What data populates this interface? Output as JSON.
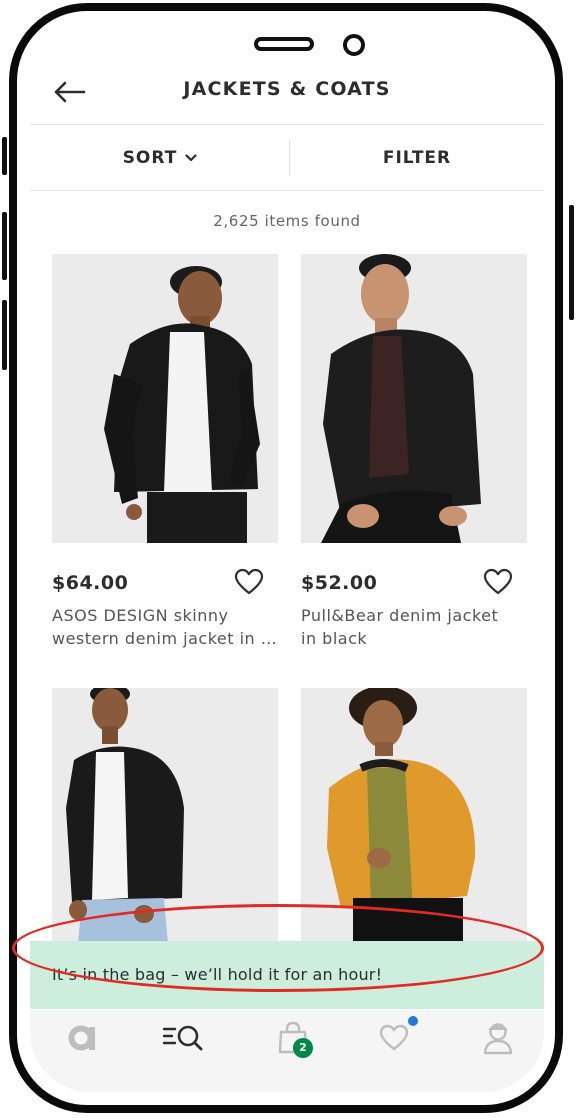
{
  "header": {
    "title": "JACKETS & COATS"
  },
  "toolbar": {
    "sort_label": "SORT",
    "filter_label": "FILTER"
  },
  "results": {
    "count_text": "2,625 items found"
  },
  "products": [
    {
      "price": "$64.00",
      "title_line1": "ASOS DESIGN skinny",
      "title_line2": "western denim jacket in b..."
    },
    {
      "price": "$52.00",
      "title_line1": "Pull&Bear denim jacket",
      "title_line2": "in black"
    },
    {
      "price": "",
      "title_line1": "",
      "title_line2": ""
    },
    {
      "price": "",
      "title_line1": "",
      "title_line2": ""
    }
  ],
  "toast": {
    "message": "It’s in the bag – we’ll hold it for an hour!"
  },
  "tabbar": {
    "bag_count": "2"
  },
  "colors": {
    "toast_bg": "#cdeedc",
    "badge_green": "#018849",
    "notification_blue": "#2478dc",
    "annotation_red": "#e02b24"
  },
  "icons": [
    "back-arrow-icon",
    "chevron-down-icon",
    "heart-icon",
    "asos-logo-icon",
    "search-icon",
    "bag-icon",
    "saved-heart-icon",
    "account-icon"
  ]
}
